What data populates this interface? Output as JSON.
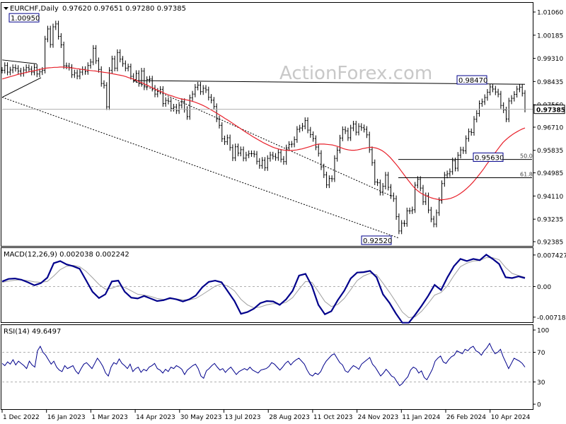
{
  "header": {
    "symbol": "EURCHF,Daily",
    "ohlc": "0.97620 0.97651 0.97280 0.97385"
  },
  "watermark": "ActionForex.com",
  "colors": {
    "candle": "#000000",
    "sma": "#e8212b",
    "macd_line": "#00008b",
    "macd_signal": "#a0a0a0",
    "rsi": "#00008b",
    "grid": "#d0d0d0",
    "frame": "#000000",
    "trendline": "#000000"
  },
  "chart_data": [
    {
      "type": "line",
      "panel": "price",
      "ylim": [
        0.92385,
        1.0106
      ],
      "yticks": [
        "1.01060",
        "1.00185",
        "0.99310",
        "0.98435",
        "0.97560",
        "0.96710",
        "0.95835",
        "0.94985",
        "0.94110",
        "0.93235",
        "0.92385"
      ],
      "ytick_values": [
        1.0106,
        1.00185,
        0.9931,
        0.98435,
        0.9756,
        0.9671,
        0.95835,
        0.94985,
        0.9411,
        0.93235,
        0.92385
      ],
      "current_price": "0.97385",
      "current_value": 0.97385,
      "series": [
        {
          "values": [
            0.9886,
            0.9904,
            0.9879,
            0.9887,
            0.9896,
            0.9893,
            0.9883,
            0.9874,
            0.9887,
            0.9896,
            0.989,
            0.9879,
            0.9897,
            0.9872,
            0.988,
            0.9886,
            1.0004,
            1.0042,
            0.9983,
            1.005,
            1.0061,
            1.0014,
            0.9982,
            0.9903,
            0.9902,
            0.9897,
            0.9869,
            0.9876,
            0.9864,
            0.9879,
            0.9889,
            0.9881,
            0.9904,
            0.9917,
            0.9969,
            0.9922,
            0.9889,
            0.9836,
            0.9829,
            0.9748,
            0.9886,
            0.9929,
            0.9894,
            0.9953,
            0.9928,
            0.9911,
            0.9894,
            0.9899,
            0.9863,
            0.9851,
            0.9874,
            0.9836,
            0.9883,
            0.9823,
            0.9851,
            0.9853,
            0.9818,
            0.9796,
            0.9807,
            0.9814,
            0.976,
            0.9772,
            0.9769,
            0.9742,
            0.9747,
            0.9733,
            0.9754,
            0.9768,
            0.9738,
            0.9711,
            0.9782,
            0.9796,
            0.9822,
            0.983,
            0.9805,
            0.9818,
            0.9812,
            0.9784,
            0.9773,
            0.9749,
            0.9702,
            0.9678,
            0.9627,
            0.9616,
            0.9631,
            0.9594,
            0.9555,
            0.9597,
            0.9573,
            0.9586,
            0.9554,
            0.9566,
            0.9571,
            0.9571,
            0.9569,
            0.9542,
            0.9526,
            0.9546,
            0.9518,
            0.9553,
            0.9566,
            0.9561,
            0.9556,
            0.9575,
            0.955,
            0.9541,
            0.9593,
            0.9606,
            0.9607,
            0.9624,
            0.9663,
            0.9668,
            0.9675,
            0.9696,
            0.966,
            0.9643,
            0.9628,
            0.9596,
            0.9572,
            0.9521,
            0.9491,
            0.9453,
            0.9477,
            0.9476,
            0.9553,
            0.9584,
            0.963,
            0.9662,
            0.9657,
            0.9631,
            0.9668,
            0.9683,
            0.9652,
            0.9674,
            0.9669,
            0.9663,
            0.9642,
            0.9586,
            0.9537,
            0.9464,
            0.9461,
            0.9425,
            0.9448,
            0.949,
            0.9444,
            0.9412,
            0.9401,
            0.9333,
            0.9279,
            0.9308,
            0.9307,
            0.9355,
            0.9355,
            0.9359,
            0.9452,
            0.9474,
            0.9441,
            0.9389,
            0.9412,
            0.9358,
            0.9324,
            0.9305,
            0.9348,
            0.9394,
            0.9458,
            0.949,
            0.9495,
            0.9503,
            0.9544,
            0.9516,
            0.9565,
            0.9585,
            0.9582,
            0.9628,
            0.9654,
            0.9651,
            0.9701,
            0.9723,
            0.976,
            0.9767,
            0.9783,
            0.9803,
            0.9823,
            0.9815,
            0.9804,
            0.9796,
            0.9753,
            0.9736,
            0.9702,
            0.977,
            0.978,
            0.9795,
            0.9815,
            0.9822,
            0.9799,
            0.9739
          ]
        },
        {
          "name": "SMA",
          "values": [
            0.9853,
            0.9856,
            0.9859,
            0.9862,
            0.9865,
            0.9868,
            0.9871,
            0.9873,
            0.9876,
            0.9878,
            0.9881,
            0.9883,
            0.9885,
            0.9887,
            0.989,
            0.9892,
            0.9894,
            0.9895,
            0.9896,
            0.9897,
            0.9897,
            0.9898,
            0.9898,
            0.9897,
            0.9896,
            0.9895,
            0.9894,
            0.9892,
            0.9891,
            0.9889,
            0.9888,
            0.9886,
            0.9885,
            0.9884,
            0.9883,
            0.9881,
            0.988,
            0.9878,
            0.9877,
            0.9875,
            0.9873,
            0.9871,
            0.9869,
            0.9867,
            0.9865,
            0.9862,
            0.9858,
            0.9855,
            0.9851,
            0.9847,
            0.9842,
            0.9838,
            0.9833,
            0.9828,
            0.9823,
            0.9818,
            0.9813,
            0.9808,
            0.9804,
            0.9799,
            0.9795,
            0.9791,
            0.9788,
            0.9784,
            0.9781,
            0.9778,
            0.9776,
            0.9774,
            0.9772,
            0.9769,
            0.9766,
            0.9762,
            0.9758,
            0.9753,
            0.9748,
            0.9742,
            0.9736,
            0.973,
            0.9724,
            0.9717,
            0.9711,
            0.9704,
            0.9698,
            0.9691,
            0.9684,
            0.9677,
            0.967,
            0.9663,
            0.9656,
            0.9649,
            0.9643,
            0.9636,
            0.963,
            0.9624,
            0.9618,
            0.9612,
            0.9607,
            0.9602,
            0.9597,
            0.9593,
            0.959,
            0.9587,
            0.9585,
            0.9584,
            0.9583,
            0.9583,
            0.9584,
            0.9585,
            0.9587,
            0.9589,
            0.9592,
            0.9595,
            0.9598,
            0.9602,
            0.9605,
            0.9607,
            0.9607,
            0.9607,
            0.9606,
            0.9605,
            0.9604,
            0.9601,
            0.9598,
            0.9594,
            0.959,
            0.9587,
            0.9585,
            0.9584,
            0.9584,
            0.9585,
            0.9587,
            0.959,
            0.9592,
            0.9594,
            0.9595,
            0.9594,
            0.9592,
            0.9588,
            0.9583,
            0.9576,
            0.9567,
            0.9557,
            0.9545,
            0.9533,
            0.952,
            0.9506,
            0.9492,
            0.9478,
            0.9465,
            0.9452,
            0.944,
            0.9431,
            0.9423,
            0.9417,
            0.9412,
            0.9408,
            0.9404,
            0.9401,
            0.9399,
            0.9397,
            0.9397,
            0.9398,
            0.94,
            0.9402,
            0.9406,
            0.9411,
            0.9417,
            0.9424,
            0.9432,
            0.9441,
            0.9451,
            0.9462,
            0.9474,
            0.9487,
            0.95,
            0.9514,
            0.9529,
            0.9543,
            0.9557,
            0.9572,
            0.9586,
            0.96,
            0.9613,
            0.9623,
            0.9632,
            0.964,
            0.9647,
            0.9653,
            0.9659,
            0.9664,
            0.9668
          ]
        }
      ],
      "annotations": [
        {
          "label": "1.00950",
          "value": 1.0095
        },
        {
          "label": "0.98470",
          "value": 0.9847
        },
        {
          "label": "0.95630",
          "value": 0.9563
        },
        {
          "label": "0.92520",
          "value": 0.9252
        }
      ],
      "fib_levels": [
        {
          "label": "50.0",
          "value": 0.9549
        },
        {
          "label": "61.8",
          "value": 0.948
        }
      ]
    },
    {
      "type": "line",
      "panel": "macd",
      "title": "MACD(12,26,9) 0.002038 0.002242",
      "ylim": [
        -0.00772,
        0.0079
      ],
      "yticks": [
        "0.007427",
        "0.00",
        "-0.007186"
      ],
      "ytick_values": [
        0.007427,
        0.0,
        -0.007186
      ],
      "series": [
        {
          "name": "MACD",
          "values": [
            0.0012,
            0.0018,
            0.0019,
            0.0016,
            0.001,
            0.0003,
            0.0008,
            0.0021,
            0.0055,
            0.006,
            0.0052,
            0.0048,
            0.0042,
            0.0015,
            -0.0012,
            -0.0027,
            -0.0018,
            0.0012,
            0.0014,
            -0.0012,
            -0.0026,
            -0.0028,
            -0.0022,
            -0.0028,
            -0.0034,
            -0.0032,
            -0.0027,
            -0.003,
            -0.0035,
            -0.003,
            -0.0021,
            -0.0002,
            0.0011,
            0.0014,
            0.001,
            -0.0012,
            -0.0034,
            -0.0064,
            -0.006,
            -0.0052,
            -0.0039,
            -0.0034,
            -0.0035,
            -0.0043,
            -0.003,
            -0.001,
            0.0026,
            0.003,
            0.0001,
            -0.0043,
            -0.0065,
            -0.0058,
            -0.0032,
            -0.001,
            0.0019,
            0.0033,
            0.0034,
            0.0037,
            0.0022,
            -0.0018,
            -0.0038,
            -0.0063,
            -0.0085,
            -0.0085,
            -0.0066,
            -0.0045,
            -0.0022,
            0.0004,
            -0.0008,
            0.0022,
            0.0048,
            0.0065,
            0.006,
            0.0065,
            0.0062,
            0.0075,
            0.0065,
            0.0053,
            0.0022,
            0.002,
            0.0024,
            0.002
          ]
        },
        {
          "name": "Signal",
          "values": [
            0.001,
            0.0013,
            0.0015,
            0.0016,
            0.0014,
            0.0011,
            0.001,
            0.0012,
            0.0025,
            0.004,
            0.0048,
            0.005,
            0.0047,
            0.0036,
            0.0021,
            0.0005,
            -0.0006,
            -0.0004,
            0.0002,
            -0.0002,
            -0.001,
            -0.0018,
            -0.002,
            -0.0023,
            -0.0028,
            -0.003,
            -0.0029,
            -0.0029,
            -0.0031,
            -0.0031,
            -0.0028,
            -0.0019,
            -0.0009,
            0.0001,
            0.0006,
            0.0001,
            -0.001,
            -0.003,
            -0.0043,
            -0.005,
            -0.0048,
            -0.0043,
            -0.004,
            -0.0041,
            -0.0037,
            -0.0026,
            -0.0006,
            0.0012,
            0.001,
            -0.0012,
            -0.0035,
            -0.0047,
            -0.0042,
            -0.0028,
            -0.0007,
            0.0014,
            0.0025,
            0.0031,
            0.0028,
            0.0008,
            -0.0013,
            -0.0036,
            -0.006,
            -0.0073,
            -0.0071,
            -0.0058,
            -0.004,
            -0.002,
            -0.0014,
            0.0002,
            0.0026,
            0.0047,
            0.0055,
            0.006,
            0.0061,
            0.0068,
            0.0068,
            0.0063,
            0.0045,
            0.0031,
            0.0026,
            0.0022
          ]
        }
      ]
    },
    {
      "type": "line",
      "panel": "rsi",
      "title": "RSI(14) 49.6497",
      "ylim": [
        0,
        100
      ],
      "yticks": [
        "100",
        "70",
        "30",
        "0"
      ],
      "ytick_values": [
        100,
        70,
        30,
        0
      ],
      "series": [
        {
          "name": "RSI",
          "values": [
            55,
            52,
            57,
            54,
            60,
            53,
            58,
            55,
            52,
            48,
            58,
            53,
            50,
            72,
            78,
            70,
            66,
            60,
            54,
            58,
            50,
            46,
            44,
            52,
            48,
            50,
            52,
            45,
            41,
            48,
            54,
            56,
            52,
            48,
            55,
            62,
            57,
            51,
            42,
            38,
            50,
            56,
            54,
            61,
            55,
            52,
            48,
            54,
            44,
            48,
            50,
            43,
            47,
            45,
            50,
            52,
            55,
            48,
            46,
            42,
            47,
            44,
            50,
            48,
            52,
            50,
            47,
            40,
            46,
            49,
            52,
            54,
            48,
            38,
            35,
            45,
            48,
            52,
            55,
            50,
            46,
            48,
            43,
            47,
            50,
            45,
            40,
            44,
            46,
            48,
            46,
            50,
            46,
            44,
            42,
            46,
            47,
            48,
            51,
            56,
            54,
            50,
            46,
            50,
            55,
            58,
            53,
            57,
            60,
            62,
            58,
            54,
            46,
            40,
            38,
            42,
            40,
            44,
            52,
            58,
            62,
            66,
            68,
            62,
            56,
            53,
            45,
            43,
            48,
            52,
            50,
            47,
            54,
            57,
            60,
            63,
            54,
            50,
            44,
            38,
            42,
            47,
            43,
            38,
            36,
            30,
            25,
            28,
            33,
            37,
            46,
            50,
            48,
            42,
            45,
            36,
            33,
            40,
            47,
            58,
            62,
            65,
            57,
            55,
            60,
            64,
            66,
            72,
            70,
            68,
            74,
            72,
            76,
            78,
            72,
            70,
            66,
            72,
            76,
            82,
            74,
            68,
            70,
            74,
            64,
            56,
            48,
            55,
            62,
            60,
            58,
            55,
            50
          ]
        }
      ]
    }
  ],
  "time_axis": {
    "labels": [
      "1 Dec 2022",
      "16 Jan 2023",
      "1 Mar 2023",
      "14 Apr 2023",
      "30 May 2023",
      "13 Jul 2023",
      "28 Aug 2023",
      "11 Oct 2023",
      "24 Nov 2023",
      "11 Jan 2024",
      "26 Feb 2024",
      "10 Apr 2024"
    ]
  }
}
